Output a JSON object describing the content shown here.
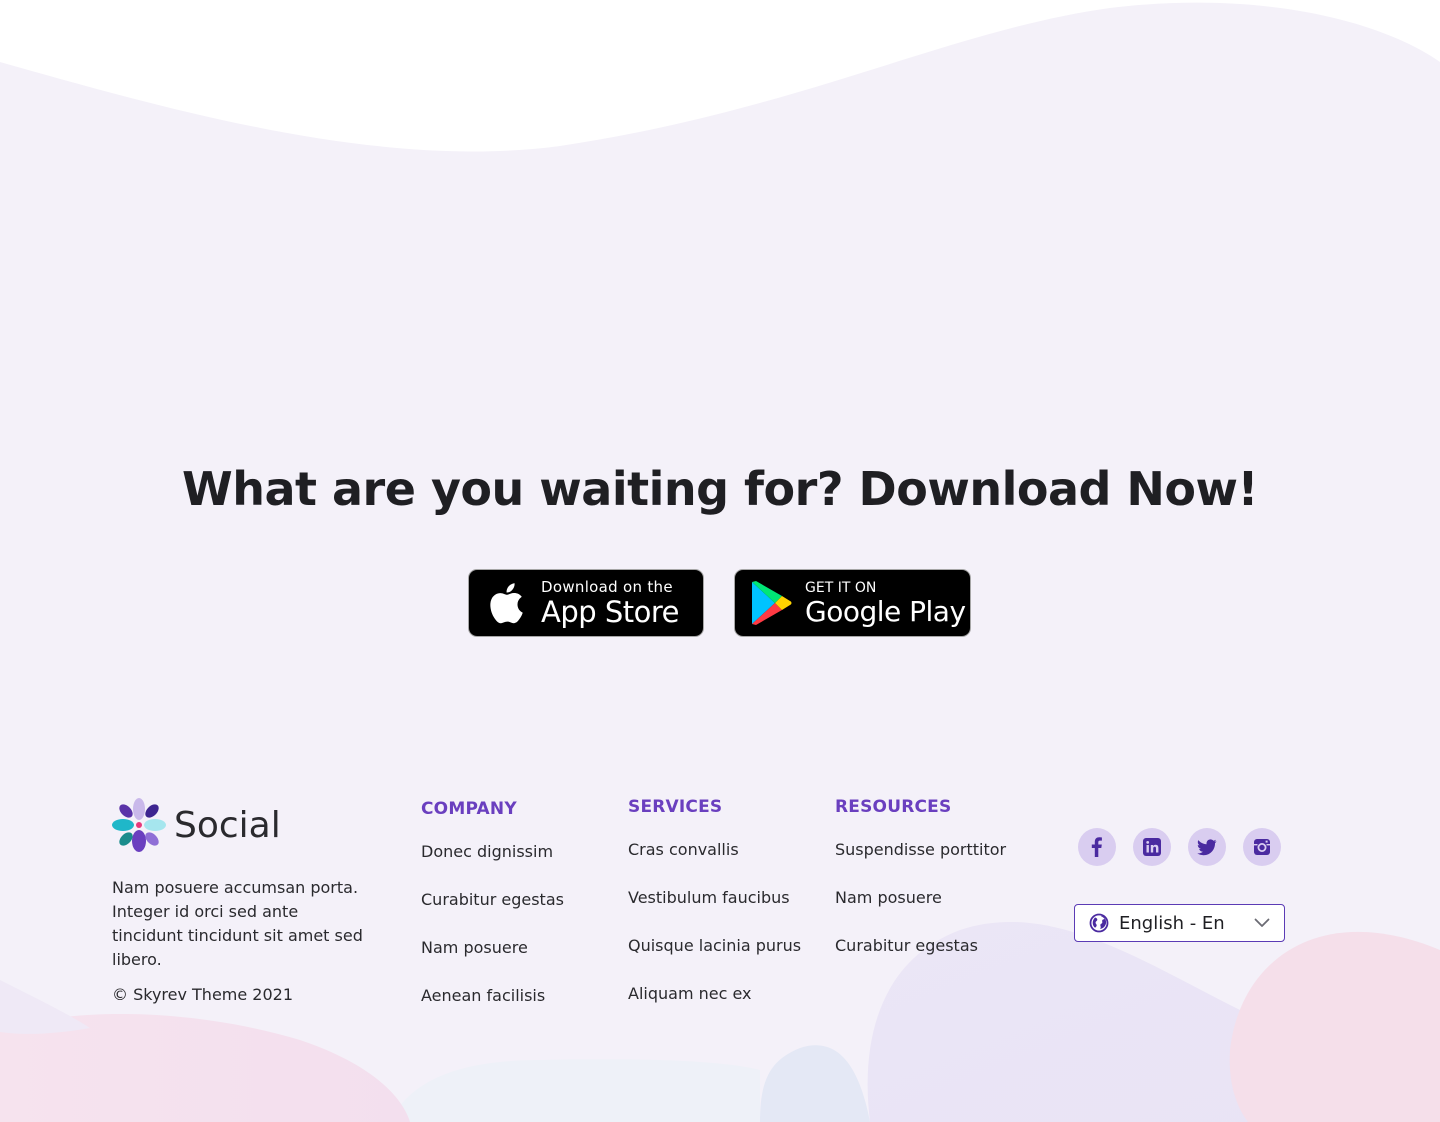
{
  "cta": {
    "headline": "What are you waiting for? Download Now!",
    "app_store": {
      "small": "Download on the",
      "big": "App Store"
    },
    "google_play": {
      "small": "GET IT ON",
      "big": "Google Play"
    }
  },
  "footer": {
    "brand": "Social",
    "about": "Nam posuere accumsan porta. Integer id orci sed ante tincidunt tincidunt sit amet sed libero.",
    "copyright": "© Skyrev Theme 2021",
    "columns": [
      {
        "title": "COMPANY",
        "links": [
          "Donec dignissim",
          "Curabitur egestas",
          "Nam posuere",
          "Aenean facilisis"
        ]
      },
      {
        "title": "SERVICES",
        "links": [
          "Cras convallis",
          "Vestibulum faucibus",
          "Quisque lacinia purus",
          "Aliquam nec ex"
        ]
      },
      {
        "title": "RESOURCES",
        "links": [
          "Suspendisse porttitor",
          "Nam posuere",
          "Curabitur egestas"
        ]
      }
    ],
    "social_icons": [
      "facebook-icon",
      "linkedin-icon",
      "twitter-icon",
      "instagram-icon"
    ],
    "language": {
      "selected": "English - En"
    }
  },
  "colors": {
    "accent": "#6a3fbf",
    "icon_bg": "#d9cdf0",
    "icon_fg": "#4a2aa0",
    "page_tint": "#f4f1f9"
  }
}
